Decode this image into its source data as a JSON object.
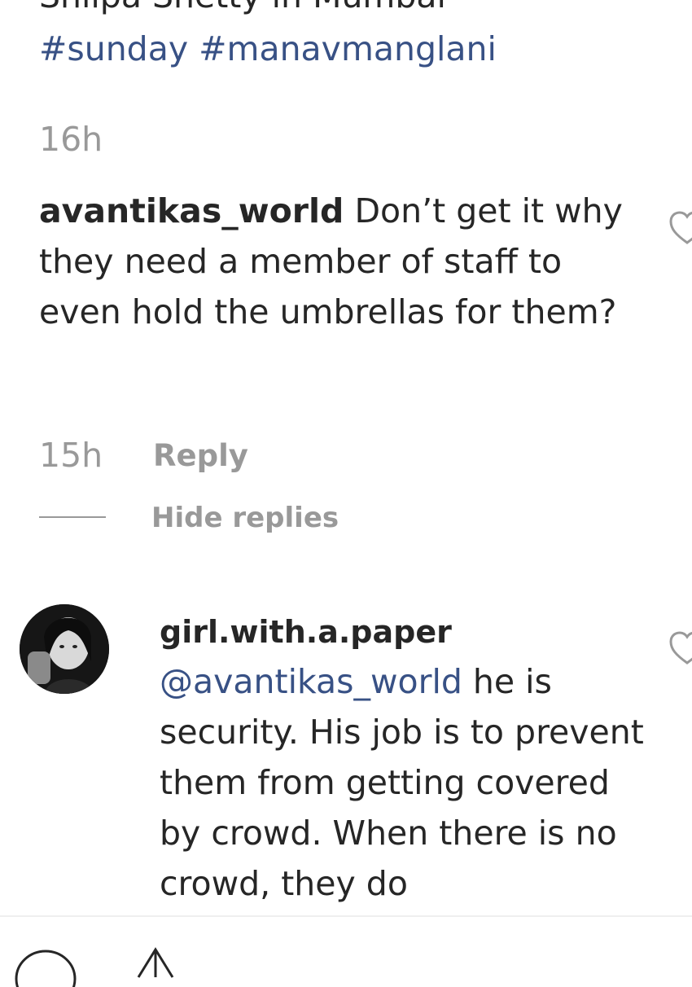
{
  "post": {
    "caption_tail": "Shilpa Shetty in Mumbai",
    "hashtags": [
      "#sunday",
      "#manavmanglani"
    ],
    "time": "16h"
  },
  "comment": {
    "username": "avantikas_world",
    "text": "Don’t get it why they need a member of staff to even hold the umbrellas for them?",
    "time": "15h",
    "reply_label": "Reply",
    "hide_replies_label": "Hide replies"
  },
  "reply": {
    "username": "girl.with.a.paper",
    "mention": "@avantikas_world",
    "text": "he is security. His job is to prevent them from getting covered by crowd. When there is no crowd, they do"
  },
  "icons": {
    "like": "heart-outline-icon",
    "comment": "comment-bubble-icon",
    "share": "share-icon"
  },
  "colors": {
    "link": "#385185",
    "meta": "#999999",
    "text": "#262626"
  }
}
